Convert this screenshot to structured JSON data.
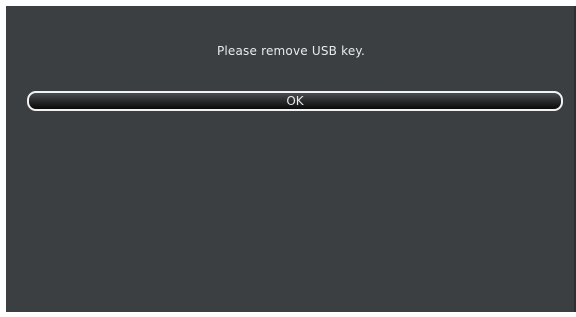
{
  "dialog": {
    "message": "Please remove USB key.",
    "ok_label": "OK"
  }
}
